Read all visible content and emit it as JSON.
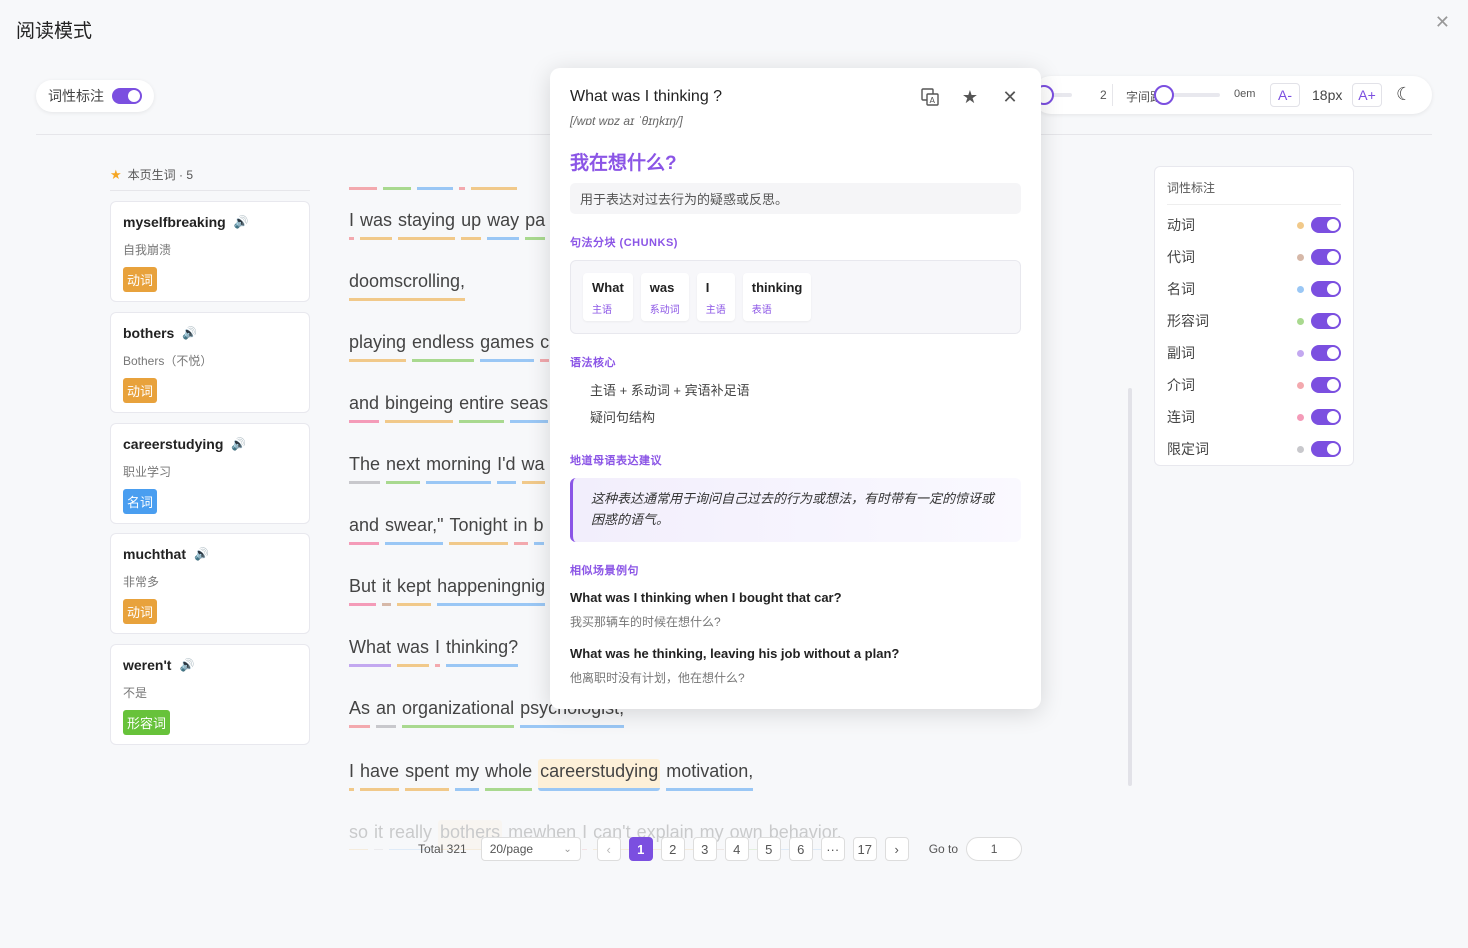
{
  "window": {
    "title": "阅读模式"
  },
  "pos_toggle": {
    "label": "词性标注"
  },
  "toolbar": {
    "line_height_value": "2",
    "letter_spacing_label": "字间距",
    "letter_spacing_value": "0em",
    "font_minus": "A-",
    "font_size": "18px",
    "font_plus": "A+"
  },
  "vocab": {
    "header": "本页生词 · 5",
    "items": [
      {
        "word": "myselfbreaking",
        "meaning": "自我崩溃",
        "tag": "动词",
        "tag_color": "#e8a23c"
      },
      {
        "word": "bothers",
        "meaning": "Bothers（不悦）",
        "tag": "动词",
        "tag_color": "#e8a23c"
      },
      {
        "word": "careerstudying",
        "meaning": "职业学习",
        "tag": "名词",
        "tag_color": "#4a9ef0"
      },
      {
        "word": "muchthat",
        "meaning": "非常多",
        "tag": "动词",
        "tag_color": "#e8a23c"
      },
      {
        "word": "weren't",
        "meaning": "不是",
        "tag": "形容词",
        "tag_color": "#67c23a"
      }
    ]
  },
  "reading": {
    "lines": [
      {
        "words": [
          "I",
          "was",
          "staying",
          "up",
          "way",
          "pa"
        ]
      },
      {
        "words": [
          "doomscrolling,"
        ]
      },
      {
        "words": [
          "playing",
          "endless",
          "games",
          "c"
        ]
      },
      {
        "words": [
          "and",
          "bingeing",
          "entire",
          "seas"
        ]
      },
      {
        "words": [
          "The",
          "next",
          "morning",
          "I'd",
          "wa"
        ]
      },
      {
        "words": [
          "and",
          "swear,\"",
          "Tonight",
          "in",
          "b"
        ]
      },
      {
        "words": [
          "But",
          "it",
          "kept",
          "happeningnig"
        ]
      },
      {
        "words": [
          "What",
          "was",
          "I",
          "thinking?"
        ]
      },
      {
        "words": [
          "As",
          "an",
          "organizational",
          "psychologist,"
        ]
      },
      {
        "words": [
          "I",
          "have",
          "spent",
          "my",
          "whole",
          "careerstudying",
          "motivation,"
        ]
      },
      {
        "words": [
          "so",
          "it",
          "really",
          "bothers",
          "mewhen",
          "I",
          "can't",
          "explain",
          "my",
          "own",
          "behavior."
        ]
      }
    ]
  },
  "pos_panel": {
    "title": "词性标注",
    "items": [
      {
        "label": "动词",
        "color": "#f1c98a"
      },
      {
        "label": "代词",
        "color": "#d6b8a8"
      },
      {
        "label": "名词",
        "color": "#9ac7f5"
      },
      {
        "label": "形容词",
        "color": "#a9d98f"
      },
      {
        "label": "副词",
        "color": "#c3a8f0"
      },
      {
        "label": "介词",
        "color": "#f3a9ae"
      },
      {
        "label": "连词",
        "color": "#f49bb8"
      },
      {
        "label": "限定词",
        "color": "#c8c8cc"
      }
    ]
  },
  "pagination": {
    "total": "Total 321",
    "page_size": "20/page",
    "pages": [
      "1",
      "2",
      "3",
      "4",
      "5",
      "6",
      "···",
      "17"
    ],
    "goto_label": "Go to",
    "goto_value": "1"
  },
  "popover": {
    "sentence": "What was I thinking ?",
    "ipa": "[/wɒt wɒz aɪ ˈθɪŋkɪŋ/]",
    "translation": "我在想什么?",
    "gloss": "用于表达对过去行为的疑惑或反思。",
    "chunks_header": "句法分块 (CHUNKS)",
    "chunks": [
      {
        "text": "What",
        "role": "主语"
      },
      {
        "text": "was",
        "role": "系动词"
      },
      {
        "text": "I",
        "role": "主语"
      },
      {
        "text": "thinking",
        "role": "表语"
      }
    ],
    "core_header": "语法核心",
    "core": [
      "主语 + 系动词 + 宾语补足语",
      "疑问句结构"
    ],
    "native_header": "地道母语表达建议",
    "native": "这种表达通常用于询问自己过去的行为或想法，有时带有一定的惊讶或困惑的语气。",
    "examples_header": "相似场景例句",
    "examples": [
      {
        "en": "What was I thinking when I bought that car?",
        "zh": "我买那辆车的时候在想什么?"
      },
      {
        "en": "What was he thinking, leaving his job without a plan?",
        "zh": "他离职时没有计划，他在想什么?"
      }
    ]
  }
}
